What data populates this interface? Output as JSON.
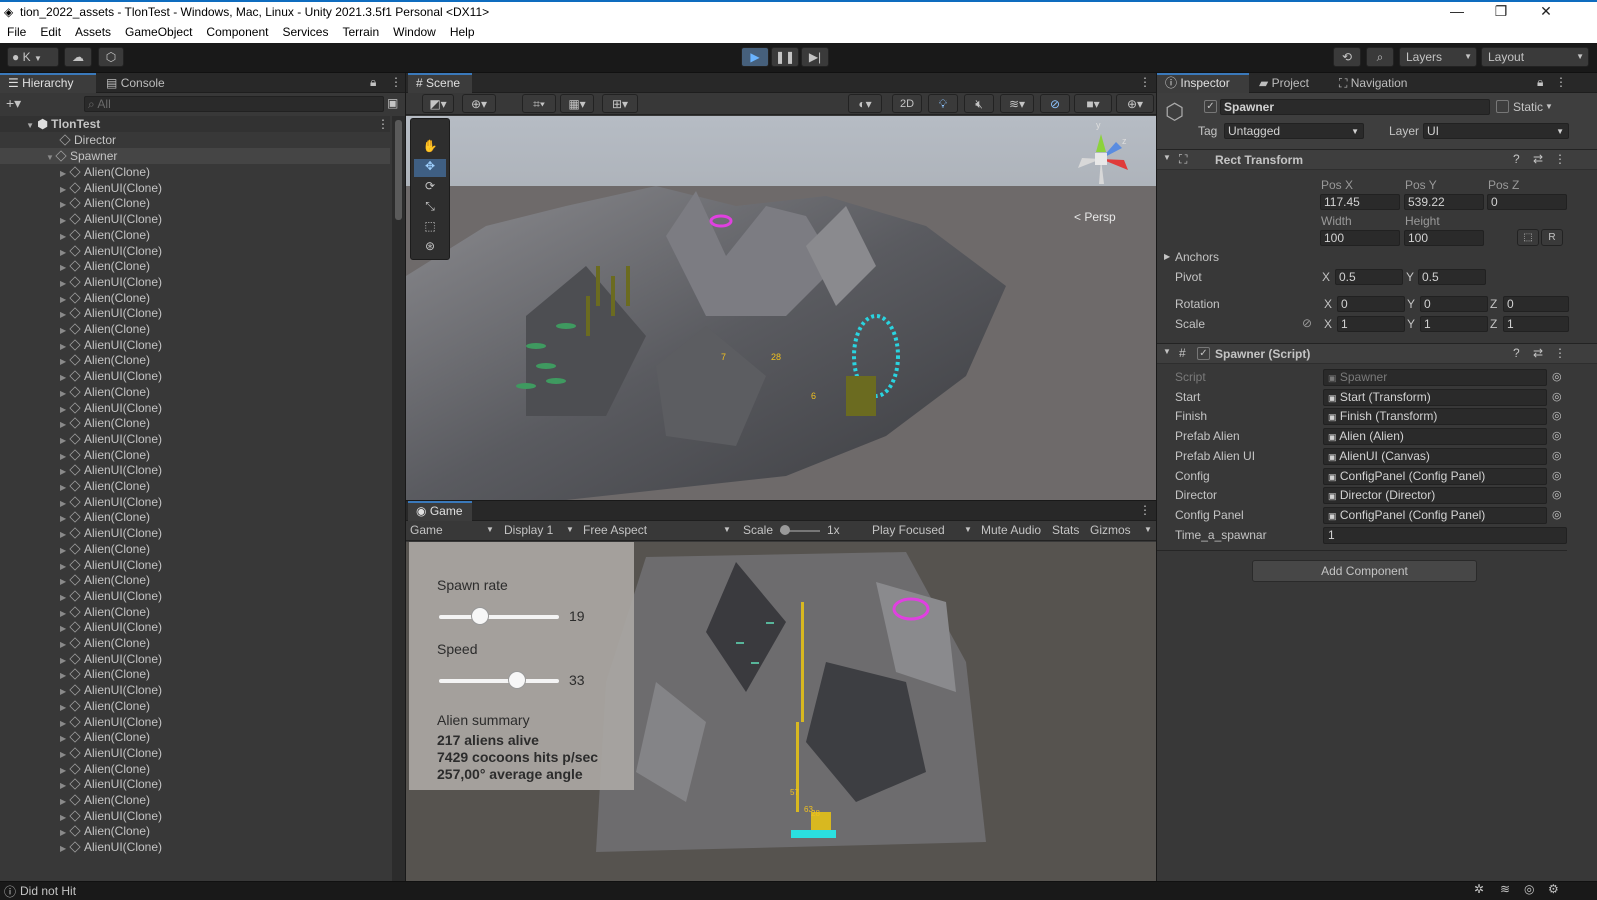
{
  "window": {
    "title": "tion_2022_assets - TlonTest - Windows, Mac, Linux - Unity 2021.3.5f1 Personal <DX11>"
  },
  "menu": [
    "File",
    "Edit",
    "Assets",
    "GameObject",
    "Component",
    "Services",
    "Terrain",
    "Window",
    "Help"
  ],
  "toolbar": {
    "account": "K",
    "layers": "Layers",
    "layout": "Layout"
  },
  "hierarchy": {
    "tab_label": "Hierarchy",
    "console_tab": "Console",
    "search_placeholder": "All",
    "scene_name": "TlonTest",
    "items": [
      "Director",
      "Spawner"
    ],
    "clones": [
      "Alien(Clone)",
      "AlienUI(Clone)",
      "Alien(Clone)",
      "AlienUI(Clone)",
      "Alien(Clone)",
      "AlienUI(Clone)",
      "Alien(Clone)",
      "AlienUI(Clone)",
      "Alien(Clone)",
      "AlienUI(Clone)",
      "Alien(Clone)",
      "AlienUI(Clone)",
      "Alien(Clone)",
      "AlienUI(Clone)",
      "Alien(Clone)",
      "AlienUI(Clone)",
      "Alien(Clone)",
      "AlienUI(Clone)",
      "Alien(Clone)",
      "AlienUI(Clone)",
      "Alien(Clone)",
      "AlienUI(Clone)",
      "Alien(Clone)",
      "AlienUI(Clone)",
      "Alien(Clone)",
      "AlienUI(Clone)",
      "Alien(Clone)",
      "AlienUI(Clone)",
      "Alien(Clone)",
      "AlienUI(Clone)",
      "Alien(Clone)",
      "AlienUI(Clone)",
      "Alien(Clone)",
      "AlienUI(Clone)",
      "Alien(Clone)",
      "AlienUI(Clone)",
      "Alien(Clone)",
      "AlienUI(Clone)",
      "Alien(Clone)",
      "AlienUI(Clone)",
      "Alien(Clone)",
      "AlienUI(Clone)",
      "Alien(Clone)",
      "AlienUI(Clone)"
    ]
  },
  "scene": {
    "tab_label": "Scene",
    "mode_2d": "2D",
    "persp_label": "Persp",
    "gizmo_y": "y",
    "gizmo_z": "z",
    "numbers": [
      "7",
      "28",
      "6"
    ]
  },
  "game": {
    "tab_label": "Game",
    "mode": "Game",
    "display": "Display 1",
    "aspect": "Free Aspect",
    "scale_label": "Scale",
    "scale_value": "1x",
    "play_focused": "Play Focused",
    "mute": "Mute Audio",
    "stats": "Stats",
    "gizmos": "Gizmos",
    "spawn_rate_label": "Spawn rate",
    "spawn_rate_value": "19",
    "spawn_rate_fraction": 0.34,
    "speed_label": "Speed",
    "speed_value": "33",
    "speed_fraction": 0.65,
    "summary_label": "Alien summary",
    "summary_lines": [
      "217 aliens alive",
      "7429 cocoons hits p/sec",
      "257,00° average angle"
    ],
    "numbers": [
      "57",
      "28",
      "63"
    ]
  },
  "inspector": {
    "tab_label": "Inspector",
    "project_tab": "Project",
    "navigation_tab": "Navigation",
    "object_name": "Spawner",
    "static_label": "Static",
    "tag_label": "Tag",
    "tag_value": "Untagged",
    "layer_label": "Layer",
    "layer_value": "UI",
    "rect_transform": {
      "title": "Rect Transform",
      "pos_x_label": "Pos X",
      "pos_x": "117.45",
      "pos_y_label": "Pos Y",
      "pos_y": "539.22",
      "pos_z_label": "Pos Z",
      "pos_z": "0",
      "width_label": "Width",
      "width": "100",
      "height_label": "Height",
      "height": "100",
      "r_button": "R",
      "anchors_label": "Anchors",
      "pivot_label": "Pivot",
      "pivot_x": "0.5",
      "pivot_y": "0.5",
      "rotation_label": "Rotation",
      "rot_x": "0",
      "rot_y": "0",
      "rot_z": "0",
      "scale_label": "Scale",
      "scale_x": "1",
      "scale_y": "1",
      "scale_z": "1",
      "x": "X",
      "y": "Y",
      "z": "Z"
    },
    "spawner_script": {
      "title": "Spawner (Script)",
      "fields": [
        {
          "label": "Script",
          "value": "Spawner"
        },
        {
          "label": "Start",
          "value": "Start (Transform)"
        },
        {
          "label": "Finish",
          "value": "Finish (Transform)"
        },
        {
          "label": "Prefab Alien",
          "value": "Alien (Alien)"
        },
        {
          "label": "Prefab Alien UI",
          "value": "AlienUI (Canvas)"
        },
        {
          "label": "Config",
          "value": "ConfigPanel (Config Panel)"
        },
        {
          "label": "Director",
          "value": "Director (Director)"
        },
        {
          "label": "Config Panel",
          "value": "ConfigPanel (Config Panel)"
        },
        {
          "label": "Time_a_spawnar",
          "value": "1"
        }
      ]
    },
    "add_component": "Add Component"
  },
  "status": {
    "message": "Did not Hit"
  }
}
